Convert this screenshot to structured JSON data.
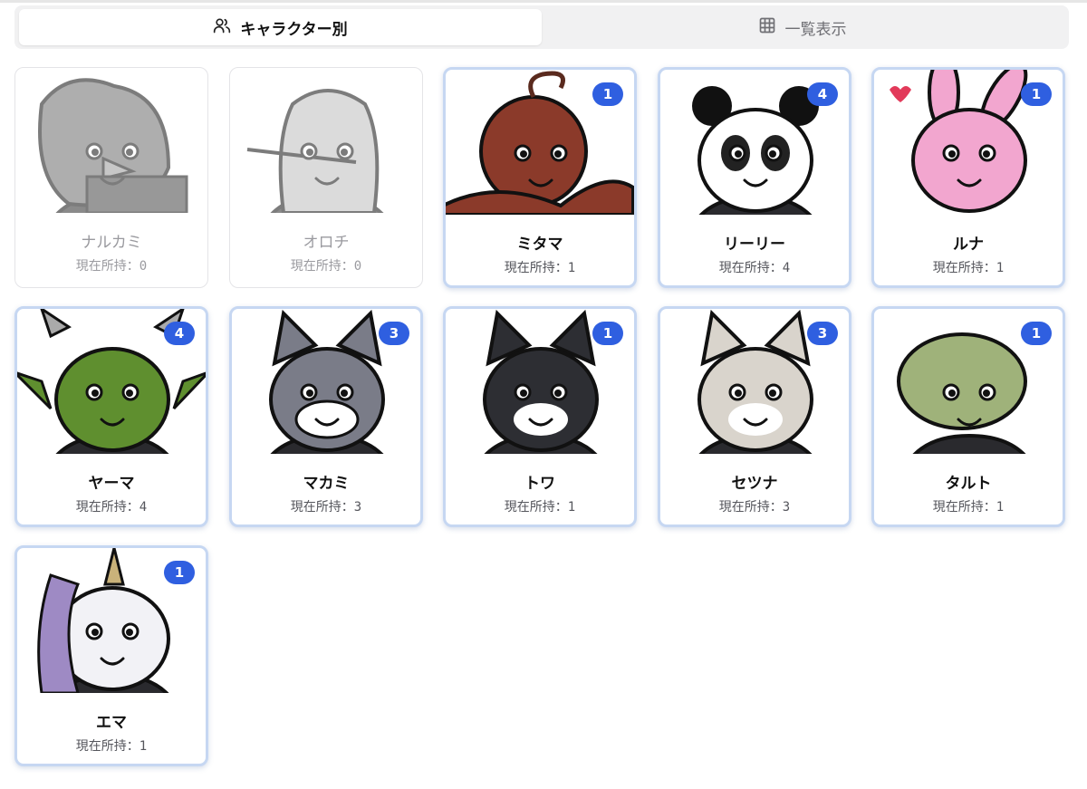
{
  "tabs": [
    {
      "label": "キャラクター別",
      "icon": "users-icon",
      "active": true
    },
    {
      "label": "一覧表示",
      "icon": "grid-icon",
      "active": false
    }
  ],
  "count_prefix": "現在所持：",
  "characters": [
    {
      "name": "ナルカミ",
      "count": "0",
      "owned": false,
      "animal": "bird",
      "color": "#6b6b6b"
    },
    {
      "name": "オロチ",
      "count": "0",
      "owned": false,
      "animal": "snake",
      "color": "#bdbdbd"
    },
    {
      "name": "ミタマ",
      "count": "1",
      "owned": true,
      "badge": "1",
      "animal": "octopus",
      "color": "#8b3a2a"
    },
    {
      "name": "リーリー",
      "count": "4",
      "owned": true,
      "badge": "4",
      "animal": "panda",
      "color": "#ffffff"
    },
    {
      "name": "ルナ",
      "count": "1",
      "owned": true,
      "badge": "1",
      "animal": "rabbit",
      "color": "#f2a6cf"
    },
    {
      "name": "ヤーマ",
      "count": "4",
      "owned": true,
      "badge": "4",
      "animal": "goblin",
      "color": "#5f8f2f"
    },
    {
      "name": "マカミ",
      "count": "3",
      "owned": true,
      "badge": "3",
      "animal": "wolf",
      "color": "#7a7c88"
    },
    {
      "name": "トワ",
      "count": "1",
      "owned": true,
      "badge": "1",
      "animal": "cat",
      "color": "#2d2e33"
    },
    {
      "name": "セツナ",
      "count": "3",
      "owned": true,
      "badge": "3",
      "animal": "maid-cat",
      "color": "#d9d4cc"
    },
    {
      "name": "タルト",
      "count": "1",
      "owned": true,
      "badge": "1",
      "animal": "turtle",
      "color": "#9fb27a"
    },
    {
      "name": "エマ",
      "count": "1",
      "owned": true,
      "badge": "1",
      "animal": "unicorn",
      "color": "#f2f2f6"
    }
  ],
  "colors": {
    "badge": "#2f5fe0",
    "owned_border": "#c6d7f2",
    "tab_bg": "#f1f1f2"
  }
}
